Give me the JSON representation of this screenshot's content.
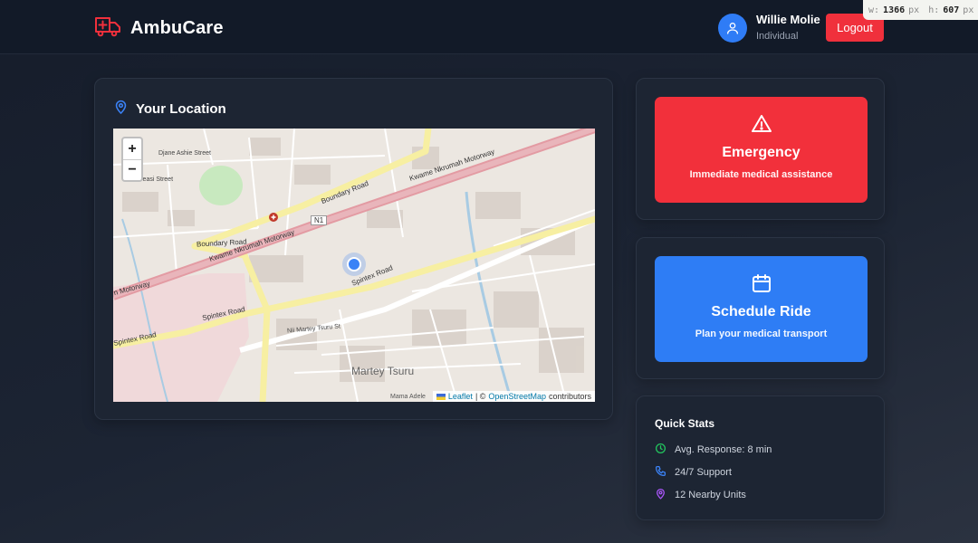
{
  "header": {
    "brand": "AmbuCare",
    "user_name": "Willie Molie",
    "user_role": "Individual",
    "logout_label": "Logout",
    "brand_color": "#f0303c"
  },
  "dim_badge": {
    "w_label": "w:",
    "w_value": "1366",
    "w_unit": "px",
    "h_label": "h:",
    "h_value": "607",
    "h_unit": "px",
    "icon": "P"
  },
  "location": {
    "title": "Your Location",
    "zoom_in": "+",
    "zoom_out": "−",
    "attribution_leaflet": "Leaflet",
    "attribution_sep": "| ©",
    "attribution_osm": "OpenStreetMap",
    "attribution_contrib": "contributors",
    "map_labels": {
      "road_motorway": "Kwame Nkrumah Motorway",
      "road_boundary": "Boundary Road",
      "road_spintex": "Spintex Road",
      "road_n1": "N1",
      "road_motorway_short": "n Motorway",
      "road_martey": "Nii Martey Tsuru St",
      "area": "Martey Tsuru",
      "street_mama": "Mama Adele",
      "street_djane": "Djane Ashie Street",
      "street_abeasi": "Abeasi Street"
    }
  },
  "emergency": {
    "title": "Emergency",
    "subtitle": "Immediate medical assistance",
    "color": "#f2303b"
  },
  "schedule": {
    "title": "Schedule Ride",
    "subtitle": "Plan your medical transport",
    "color": "#2e7df5"
  },
  "stats": {
    "title": "Quick Stats",
    "items": [
      {
        "icon": "clock-icon",
        "text": "Avg. Response: 8 min",
        "color": "#22c55e"
      },
      {
        "icon": "phone-icon",
        "text": "24/7 Support",
        "color": "#3b82f6"
      },
      {
        "icon": "map-pin-icon",
        "text": "12 Nearby Units",
        "color": "#a855f7"
      }
    ]
  }
}
